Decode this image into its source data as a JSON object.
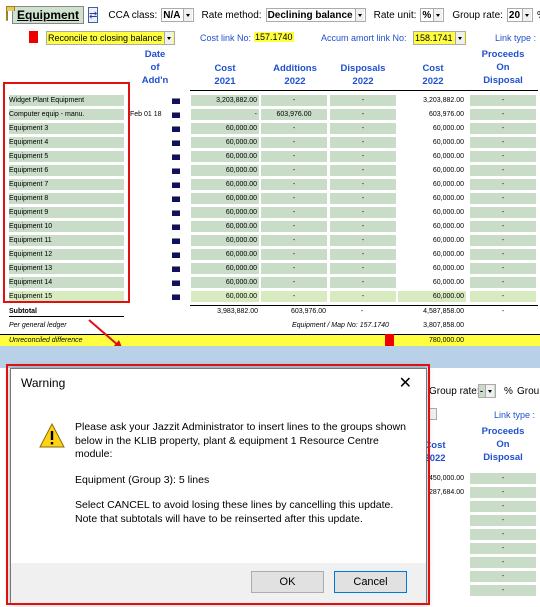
{
  "toolbar": {
    "title": "Equipment",
    "cca_label": "CCA class:",
    "cca_value": "N/A",
    "rate_method_label": "Rate method:",
    "rate_method_value": "Declining balance",
    "rate_unit_label": "Rate unit:",
    "rate_unit_value": "%",
    "group_rate_label": "Group rate:",
    "group_rate_value": "20",
    "group_rate_unit": "%",
    "trailing": "G"
  },
  "row2": {
    "reconcile": "Reconcile to closing balance",
    "cost_link_label": "Cost link No:",
    "cost_link_value": "157.1740",
    "accum_label": "Accum amort link No:",
    "accum_value": "158.1741",
    "link_type": "Link type :"
  },
  "headers": {
    "date": [
      "Date",
      "of",
      "Add'n"
    ],
    "cost": [
      "Cost",
      "2021"
    ],
    "additions": [
      "Additions",
      "2022"
    ],
    "disposals": [
      "Disposals",
      "2022"
    ],
    "cost2": [
      "Cost",
      "2022"
    ],
    "proceeds": [
      "Proceeds",
      "On",
      "Disposal"
    ]
  },
  "rows": [
    {
      "name": "Widget Plant Equipment",
      "date": "",
      "cost": "3,203,882.00",
      "add": "-",
      "disp": "-",
      "cost2": "3,203,882.00",
      "proc": "-"
    },
    {
      "name": "Computer equip - manu.",
      "date": "Feb 01 18",
      "cost": "-",
      "add": "603,976.00",
      "disp": "-",
      "cost2": "603,976.00",
      "proc": "-"
    },
    {
      "name": "Equipment 3",
      "date": "",
      "cost": "60,000.00",
      "add": "-",
      "disp": "-",
      "cost2": "60,000.00",
      "proc": "-"
    },
    {
      "name": "Equipment 4",
      "date": "",
      "cost": "60,000.00",
      "add": "-",
      "disp": "-",
      "cost2": "60,000.00",
      "proc": "-"
    },
    {
      "name": "Equipment 5",
      "date": "",
      "cost": "60,000.00",
      "add": "-",
      "disp": "-",
      "cost2": "60,000.00",
      "proc": "-"
    },
    {
      "name": "Equipment 6",
      "date": "",
      "cost": "60,000.00",
      "add": "-",
      "disp": "-",
      "cost2": "60,000.00",
      "proc": "-"
    },
    {
      "name": "Equipment 7",
      "date": "",
      "cost": "60,000.00",
      "add": "-",
      "disp": "-",
      "cost2": "60,000.00",
      "proc": "-"
    },
    {
      "name": "Equipment 8",
      "date": "",
      "cost": "60,000.00",
      "add": "-",
      "disp": "-",
      "cost2": "60,000.00",
      "proc": "-"
    },
    {
      "name": "Equipment 9",
      "date": "",
      "cost": "60,000.00",
      "add": "-",
      "disp": "-",
      "cost2": "60,000.00",
      "proc": "-"
    },
    {
      "name": "Equipment 10",
      "date": "",
      "cost": "60,000.00",
      "add": "-",
      "disp": "-",
      "cost2": "60,000.00",
      "proc": "-"
    },
    {
      "name": "Equipment 11",
      "date": "",
      "cost": "60,000.00",
      "add": "-",
      "disp": "-",
      "cost2": "60,000.00",
      "proc": "-"
    },
    {
      "name": "Equipment 12",
      "date": "",
      "cost": "60,000.00",
      "add": "-",
      "disp": "-",
      "cost2": "60,000.00",
      "proc": "-"
    },
    {
      "name": "Equipment 13",
      "date": "",
      "cost": "60,000.00",
      "add": "-",
      "disp": "-",
      "cost2": "60,000.00",
      "proc": "-"
    },
    {
      "name": "Equipment 14",
      "date": "",
      "cost": "60,000.00",
      "add": "-",
      "disp": "-",
      "cost2": "60,000.00",
      "proc": "-"
    },
    {
      "name": "Equipment 15",
      "date": "",
      "cost": "60,000.00",
      "add": "-",
      "disp": "-",
      "cost2": "60,000.00",
      "proc": "-"
    }
  ],
  "subtotal": {
    "label": "Subtotal",
    "cost": "3,983,882.00",
    "add": "603,976.00",
    "disp": "-",
    "cost2": "4,587,858.00",
    "proc": "-"
  },
  "ledger": {
    "label": "Per general ledger",
    "map": "Equipment / Map No: 157.1740",
    "value": "3,807,858.00"
  },
  "unrec": {
    "label": "Unreconciled difference",
    "value": "780,000.00"
  },
  "behind": {
    "group_rate_label": "Group rate:",
    "group_rate_value": "-",
    "group_rate_unit": "%",
    "trailing": "Grou",
    "link_type": "Link type :",
    "cost": [
      "Cost",
      "2022"
    ],
    "proceeds": [
      "Proceeds",
      "On",
      "Disposal"
    ],
    "vals": [
      "450,000.00",
      "287,684.00"
    ]
  },
  "dialog": {
    "title": "Warning",
    "p1": "Please ask your Jazzit Administrator to insert lines to the groups shown below in the KLIB property, plant & equipment 1 Resource Centre module:",
    "p2": "Equipment (Group 3): 5 lines",
    "p3": "Select CANCEL to avoid losing these lines by cancelling this update. Note that subtotals will have to be reinserted after this update.",
    "ok": "OK",
    "cancel": "Cancel"
  },
  "colors": {
    "highlight": "#e01010",
    "cell_green": "#c8dcc8",
    "yellow": "#ffff40",
    "link_blue": "#2050d0"
  }
}
